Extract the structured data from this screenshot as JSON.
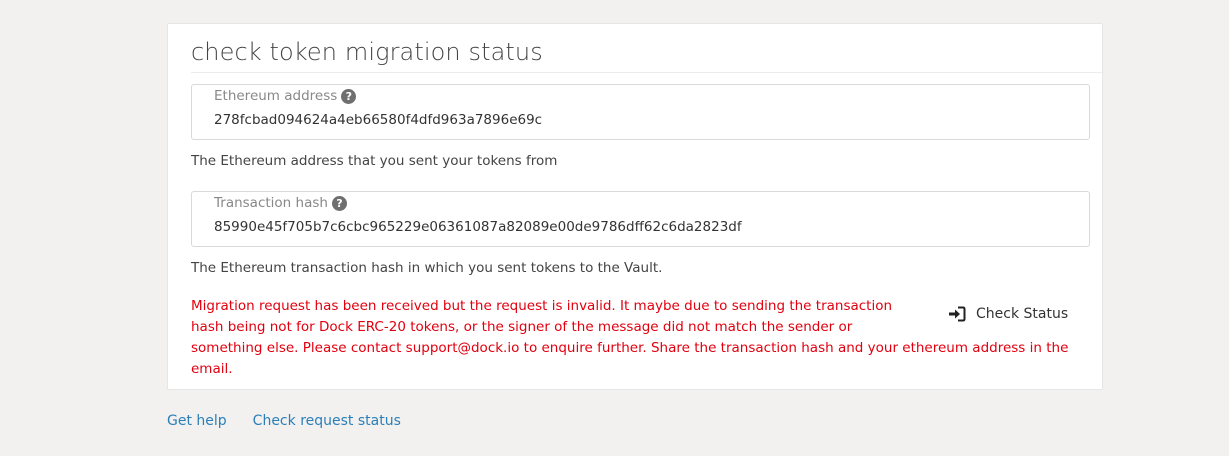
{
  "card": {
    "title": "check token migration status",
    "ethereum_field": {
      "label": "Ethereum address",
      "value": "278fcbad094624a4eb66580f4dfd963a7896e69c",
      "hint": "The Ethereum address that you sent your tokens from"
    },
    "tx_field": {
      "label": "Transaction hash",
      "value": "85990e45f705b7c6cbc965229e06361087a82089e00de9786dff62c6da2823df",
      "hint": "The Ethereum transaction hash in which you sent tokens to the Vault."
    },
    "error": {
      "lines": [
        "Migration request has been received but the request is invalid. It maybe due to sending the transaction",
        "hash being not for Dock ERC-20 tokens, or the signer of the message did not match the sender or",
        "something else. Please contact support@dock.io to enquire further. Share the transaction hash and your ethereum address in the",
        "email."
      ],
      "color": "#e2000f"
    },
    "check_button_label": "Check Status"
  },
  "footer": {
    "get_help": "Get help",
    "check_request_status": "Check request status",
    "link_color": "#2b7fb8"
  },
  "icons": {
    "help": "question-circle-icon",
    "check_button": "sign-in-icon"
  }
}
